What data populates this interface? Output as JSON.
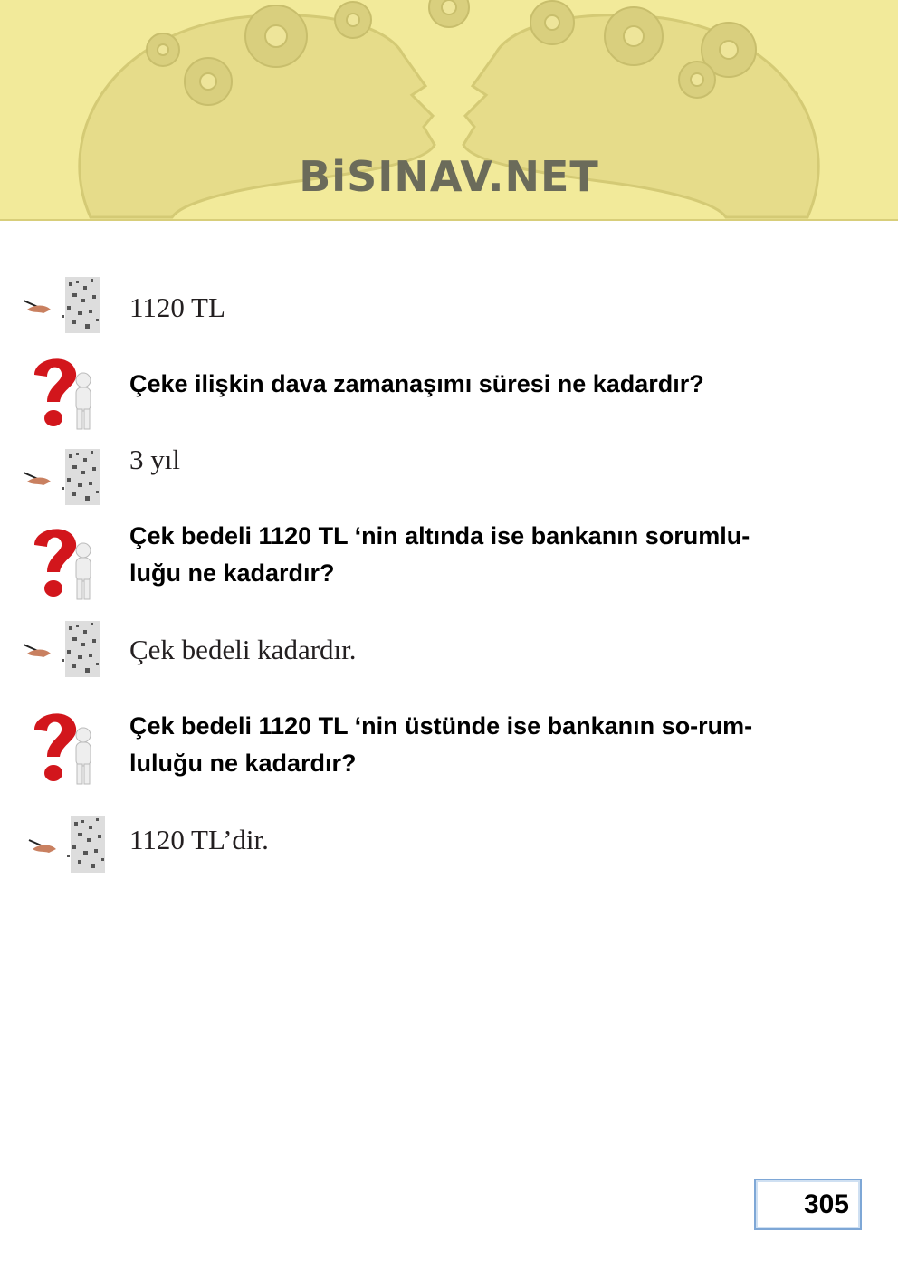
{
  "header": {
    "brand": "BiSINAV.NET"
  },
  "items": [
    {
      "type": "answer",
      "text": "1120 TL"
    },
    {
      "type": "question",
      "lines": [
        "Çeke ilişkin dava zamanaşımı süresi ne kadardır?"
      ]
    },
    {
      "type": "answer",
      "text": "3 yıl"
    },
    {
      "type": "question",
      "lines": [
        "Çek bedeli 1120 TL ‘nin altında ise bankanın sorumlu-",
        "luğu ne kadardır?"
      ]
    },
    {
      "type": "answer",
      "text": "Çek bedeli kadardır."
    },
    {
      "type": "question",
      "lines": [
        "Çek bedeli 1120 TL ‘nin üstünde ise bankanın so-rum-",
        "luluğu ne kadardır?"
      ]
    },
    {
      "type": "answer",
      "text": "1120 TL’dir."
    }
  ],
  "footer": {
    "page_number": "305"
  },
  "colors": {
    "header_bg": "#f2ea9a",
    "question_mark": "#d2161c",
    "page_box_border": "#7ea7d6"
  },
  "icons": {
    "answer": "pen-writing-icon",
    "question": "question-mark-figure-icon"
  }
}
